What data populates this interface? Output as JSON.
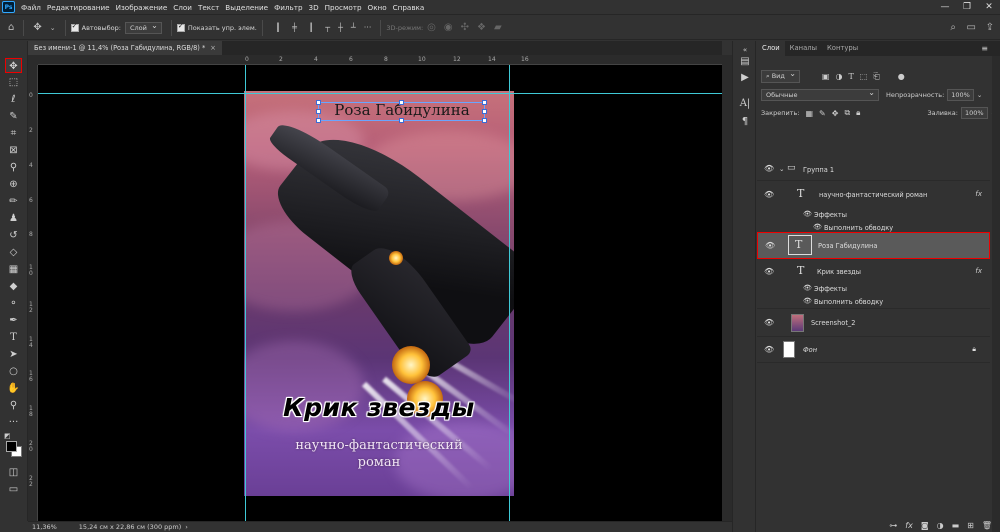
{
  "app": {
    "logo": "Ps",
    "menu": [
      "Файл",
      "Редактирование",
      "Изображение",
      "Слои",
      "Текст",
      "Выделение",
      "Фильтр",
      "3D",
      "Просмотр",
      "Окно",
      "Справка"
    ],
    "window_controls": [
      "—",
      "❐",
      "✕"
    ]
  },
  "options_bar": {
    "auto_select_label": "Автовыбор:",
    "auto_select_value": "Слой",
    "show_controls_label": "Показать упр. элем.",
    "mode_3d_label": "3D-режим:"
  },
  "document": {
    "tab_title": "Без имени-1 @ 11,4% (Роза Габидулина, RGB/8) *",
    "close": "×",
    "zoom": "11,36%",
    "doc_info": "15,24 см x 22,86 см (300 ppm)",
    "ruler_top": [
      "0",
      "2",
      "4",
      "6",
      "8",
      "10",
      "12",
      "14",
      "16"
    ],
    "ruler_left": [
      "0",
      "2",
      "4",
      "6",
      "8",
      "1 0",
      "1 2",
      "1 4",
      "1 6",
      "1 8",
      "2 0",
      "2 2"
    ]
  },
  "cover": {
    "author": "Роза Габидулина",
    "title": "Крик звезды",
    "genre_line1": "научно-фантастический",
    "genre_line2": "роман"
  },
  "layers_panel": {
    "tabs": [
      "Слои",
      "Каналы",
      "Контуры"
    ],
    "filter_value": "Вид",
    "blend_mode": "Обычные",
    "opacity_label": "Непрозрачность:",
    "opacity_value": "100%",
    "lock_label": "Закрепить:",
    "fill_label": "Заливка:",
    "fill_value": "100%",
    "layers": {
      "group": "Группа 1",
      "genre": "научно-фантастический  роман",
      "effects": "Эффекты",
      "stroke": "Выполнить обводку",
      "author": "Роза Габидулина",
      "title": "Крик звезды",
      "effects2": "Эффекты",
      "stroke2": "Выполнить обводку",
      "screenshot": "Screenshot_2",
      "background": "Фон"
    },
    "fx": "fx"
  },
  "colors": {
    "selection_highlight": "#e00000",
    "guides": "#3fc9d6",
    "ui_bg": "#323232"
  }
}
